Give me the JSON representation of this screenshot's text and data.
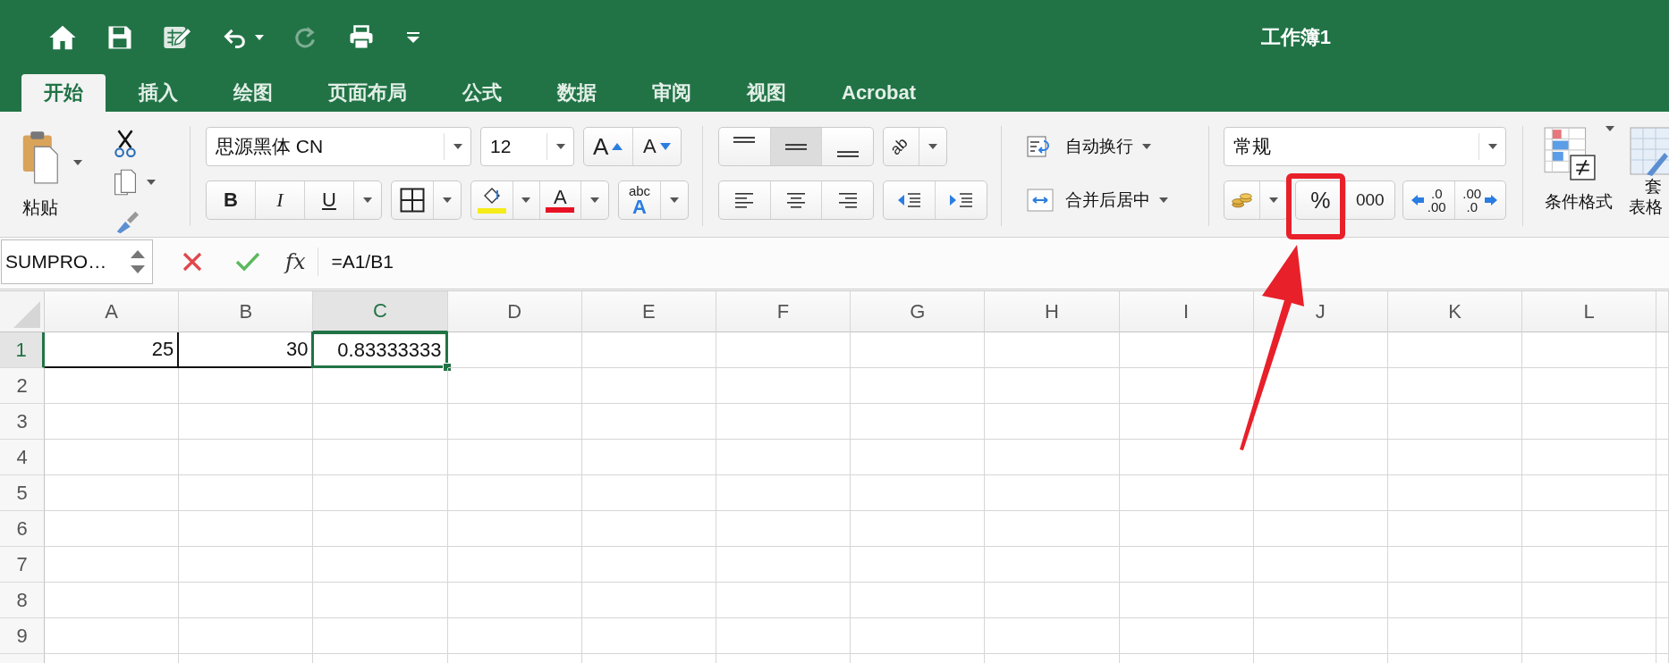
{
  "window": {
    "title": "工作簿1"
  },
  "quick_access": [
    {
      "kind": "home",
      "disabled": false
    },
    {
      "kind": "save",
      "disabled": false
    },
    {
      "kind": "edit",
      "disabled": false
    },
    {
      "kind": "undo",
      "disabled": false
    },
    {
      "kind": "redo",
      "disabled": true
    },
    {
      "kind": "print",
      "disabled": false
    },
    {
      "kind": "customize",
      "disabled": false
    }
  ],
  "tabs": [
    {
      "label": "开始",
      "selected": true
    },
    {
      "label": "插入",
      "selected": false
    },
    {
      "label": "绘图",
      "selected": false
    },
    {
      "label": "页面布局",
      "selected": false
    },
    {
      "label": "公式",
      "selected": false
    },
    {
      "label": "数据",
      "selected": false
    },
    {
      "label": "审阅",
      "selected": false
    },
    {
      "label": "视图",
      "selected": false
    },
    {
      "label": "Acrobat",
      "selected": false
    }
  ],
  "ribbon": {
    "clipboard": {
      "paste_label": "粘贴"
    },
    "font": {
      "font_name": "思源黑体 CN",
      "font_size": "12",
      "grow_label": "A",
      "shrink_label": "A",
      "bold_label": "B",
      "italic_label": "I",
      "underline_label": "U",
      "font_color_label": "A",
      "phonetic_labels": [
        "abc",
        "A"
      ]
    },
    "alignment": {
      "vertical": [
        {
          "selected": false
        },
        {
          "selected": true
        },
        {
          "selected": false
        }
      ],
      "horizontal": [
        {
          "selected": false
        },
        {
          "selected": false
        },
        {
          "selected": false
        }
      ],
      "orientation_label": "ab",
      "wrap_text": "自动换行",
      "merge_center": "合并后居中"
    },
    "number": {
      "format": "常规",
      "percent": "%",
      "comma": "000",
      "increase_decimal": [
        ".0",
        ".00"
      ],
      "decrease_decimal": [
        ".00",
        ".0"
      ]
    },
    "styles": {
      "conditional_formatting": "条件格式",
      "table_format": [
        "套",
        "表格"
      ]
    }
  },
  "formula_bar": {
    "name_box": "SUMPRO…",
    "fx_label": "fx",
    "formula": "=A1/B1"
  },
  "sheet": {
    "columns": [
      {
        "label": "A",
        "selected": false
      },
      {
        "label": "B",
        "selected": false
      },
      {
        "label": "C",
        "selected": true
      },
      {
        "label": "D",
        "selected": false
      },
      {
        "label": "E",
        "selected": false
      },
      {
        "label": "F",
        "selected": false
      },
      {
        "label": "G",
        "selected": false
      },
      {
        "label": "H",
        "selected": false
      },
      {
        "label": "I",
        "selected": false
      },
      {
        "label": "J",
        "selected": false
      },
      {
        "label": "K",
        "selected": false
      },
      {
        "label": "L",
        "selected": false
      }
    ],
    "rows": [
      {
        "label": "1",
        "selected": true,
        "cells": [
          {
            "value": "25",
            "bordered": true,
            "selected": false
          },
          {
            "value": "30",
            "bordered": true,
            "selected": false
          },
          {
            "value": "0.83333333",
            "bordered": false,
            "selected": true
          }
        ]
      },
      {
        "label": "2",
        "selected": false,
        "cells": []
      },
      {
        "label": "3",
        "selected": false,
        "cells": []
      },
      {
        "label": "4",
        "selected": false,
        "cells": []
      },
      {
        "label": "5",
        "selected": false,
        "cells": []
      },
      {
        "label": "6",
        "selected": false,
        "cells": []
      },
      {
        "label": "7",
        "selected": false,
        "cells": []
      },
      {
        "label": "8",
        "selected": false,
        "cells": []
      },
      {
        "label": "9",
        "selected": false,
        "cells": []
      }
    ]
  }
}
